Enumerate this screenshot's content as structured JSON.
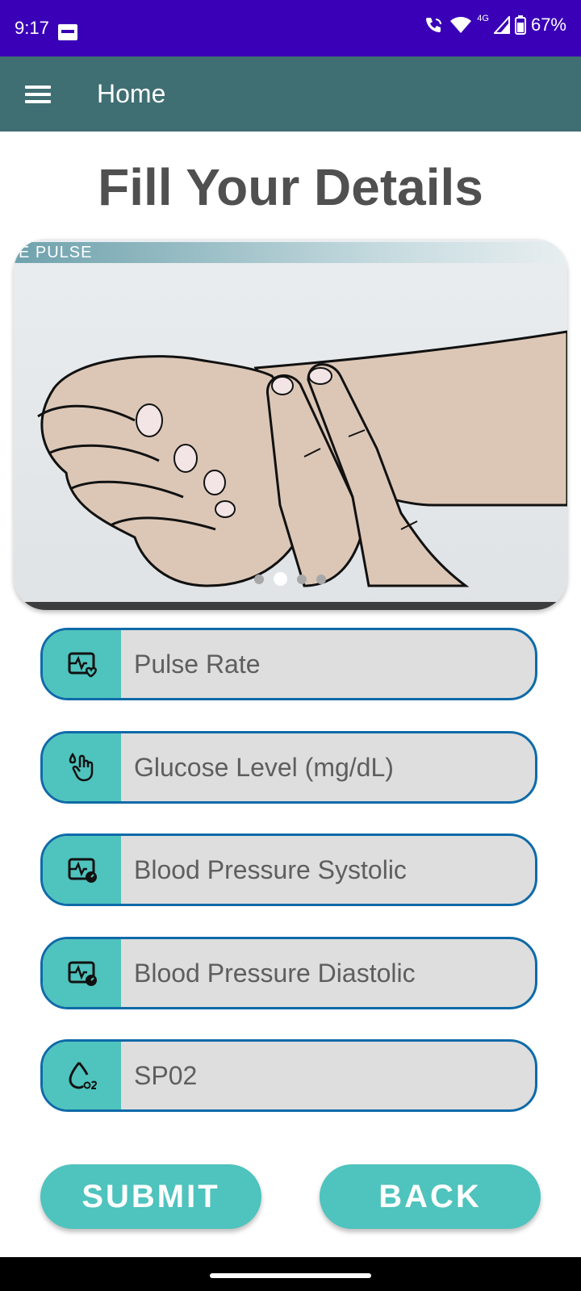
{
  "status_bar": {
    "time": "9:17",
    "network": "4G",
    "battery": "67%"
  },
  "app_bar": {
    "title": "Home"
  },
  "page": {
    "heading": "Fill Your Details"
  },
  "carousel": {
    "banner_text": "E PULSE",
    "total_slides": 4,
    "active_slide": 2
  },
  "fields": [
    {
      "placeholder": "Pulse Rate",
      "icon": "heart-monitor-icon"
    },
    {
      "placeholder": "Glucose Level (mg/dL)",
      "icon": "finger-drop-icon"
    },
    {
      "placeholder": "Blood Pressure Systolic",
      "icon": "blood-pressure-icon"
    },
    {
      "placeholder": "Blood Pressure Diastolic",
      "icon": "blood-pressure-icon"
    },
    {
      "placeholder": "SP02",
      "icon": "oxygen-drop-icon"
    }
  ],
  "buttons": {
    "submit": "SUBMIT",
    "back": "BACK"
  },
  "colors": {
    "status_bar": "#3a00b8",
    "app_bar": "#3f6e73",
    "accent": "#4fc3bd",
    "field_border": "#0e6aa8"
  }
}
